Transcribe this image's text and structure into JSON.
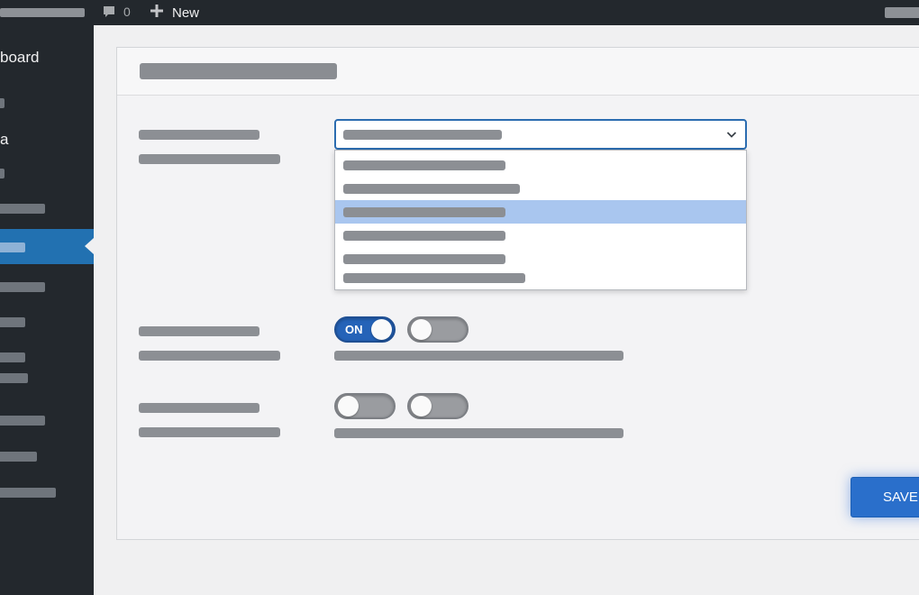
{
  "adminbar": {
    "comment_count": "0",
    "new_label": "New",
    "icons": {
      "comments": "speech-bubble-icon",
      "new": "plus-icon"
    }
  },
  "sidebar": {
    "dashboard_label": "board",
    "media_label": "a"
  },
  "select": {
    "highlighted_option_index": 2,
    "option_count": 6
  },
  "toggles": {
    "row1_first": {
      "state": "on",
      "label": "ON"
    },
    "row1_second": {
      "state": "off"
    },
    "row2_first": {
      "state": "off"
    },
    "row2_second": {
      "state": "off"
    }
  },
  "save_label": "SAVE",
  "colors": {
    "accent": "#2271b1",
    "admin_bg": "#23282d",
    "highlight": "#a9c6ef"
  }
}
